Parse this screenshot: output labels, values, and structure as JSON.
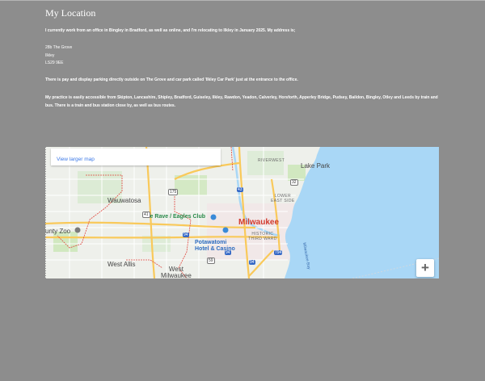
{
  "page": {
    "title": "My Location",
    "intro": "I currently work from an office in Bingley in Bradford, as well as online, and I'm relocating to Ilkley in January 2025. My address is;",
    "address_lines": [
      "28b The Grove",
      "Ilkley",
      "LS29 9EE"
    ],
    "parking": "There is pay and display parking directly outside on The Grove and car park called 'Ilkley Car Park' just at the entrance to the office.",
    "transport": " My practice is easily accessible from Skipton, Lancashire, Shipley, Bradford, Guiseley, Ilkley, Rawdon, Yeadon, Calverley, Horsforth, Apperley Bridge, Pudsey, Baildon, Bingley, Otley and Leeds by train and bus. There is a train and bus station close by, as well as bus routes."
  },
  "map": {
    "larger_map_link": "View larger map",
    "zoom_in_label": "+",
    "labels": {
      "riverwest": "RIVERWEST",
      "lake_park": "Lake Park",
      "wauwatosa": "Wauwatosa",
      "lower_east_side": [
        "LOWER",
        "EAST SIDE"
      ],
      "rave": "The Rave / Eagles Club",
      "milwaukee": "Milwaukee",
      "zoo": "unty Zoo",
      "historic_third_ward": [
        "HISTORIC",
        "THIRD WARD"
      ],
      "potawatomi": [
        "Potawatomi",
        "Hotel & Casino"
      ],
      "milwaukee_bay": "Milwaukee Bay",
      "west_allis": "West Allis",
      "west_milwaukee": [
        "West",
        "Milwaukee"
      ]
    },
    "shields": {
      "r175": "175",
      "r43": "43",
      "r32": "32",
      "r94a": "94",
      "r94b": "94",
      "r794": "794",
      "r59": "59",
      "r94c": "94",
      "r41": "41"
    },
    "colors": {
      "water": "#a9d7f6",
      "land": "#eef0eb",
      "park": "#c9e6b5",
      "highway": "#f9c95a",
      "boundary": "#e0473f"
    }
  }
}
